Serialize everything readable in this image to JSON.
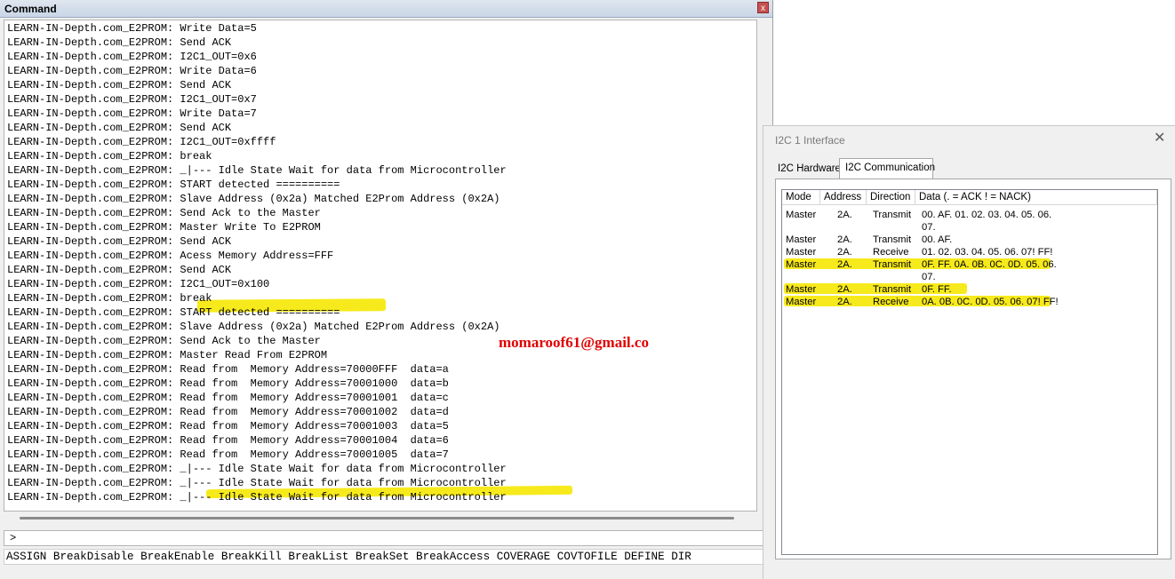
{
  "command_window": {
    "title": "Command",
    "close_glyph": "x",
    "lines": [
      "LEARN-IN-Depth.com_E2PROM: Write Data=5",
      "LEARN-IN-Depth.com_E2PROM: Send ACK",
      "LEARN-IN-Depth.com_E2PROM: I2C1_OUT=0x6",
      "LEARN-IN-Depth.com_E2PROM: Write Data=6",
      "LEARN-IN-Depth.com_E2PROM: Send ACK",
      "LEARN-IN-Depth.com_E2PROM: I2C1_OUT=0x7",
      "LEARN-IN-Depth.com_E2PROM: Write Data=7",
      "LEARN-IN-Depth.com_E2PROM: Send ACK",
      "LEARN-IN-Depth.com_E2PROM: I2C1_OUT=0xffff",
      "LEARN-IN-Depth.com_E2PROM: break",
      "LEARN-IN-Depth.com_E2PROM: _|--- Idle State Wait for data from Microcontroller",
      "LEARN-IN-Depth.com_E2PROM: START detected ==========",
      "LEARN-IN-Depth.com_E2PROM: Slave Address (0x2a) Matched E2Prom Address (0x2A)",
      "LEARN-IN-Depth.com_E2PROM: Send Ack to the Master",
      "LEARN-IN-Depth.com_E2PROM: Master Write To E2PROM",
      "LEARN-IN-Depth.com_E2PROM: Send ACK",
      "LEARN-IN-Depth.com_E2PROM: Acess Memory Address=FFF",
      "LEARN-IN-Depth.com_E2PROM: Send ACK",
      "LEARN-IN-Depth.com_E2PROM: I2C1_OUT=0x100",
      "LEARN-IN-Depth.com_E2PROM: break",
      "LEARN-IN-Depth.com_E2PROM: START detected ==========",
      "LEARN-IN-Depth.com_E2PROM: Slave Address (0x2a) Matched E2Prom Address (0x2A)",
      "LEARN-IN-Depth.com_E2PROM: Send Ack to the Master",
      "LEARN-IN-Depth.com_E2PROM: Master Read From E2PROM",
      "LEARN-IN-Depth.com_E2PROM: Read from  Memory Address=70000FFF  data=a",
      "LEARN-IN-Depth.com_E2PROM: Read from  Memory Address=70001000  data=b",
      "LEARN-IN-Depth.com_E2PROM: Read from  Memory Address=70001001  data=c",
      "LEARN-IN-Depth.com_E2PROM: Read from  Memory Address=70001002  data=d",
      "LEARN-IN-Depth.com_E2PROM: Read from  Memory Address=70001003  data=5",
      "LEARN-IN-Depth.com_E2PROM: Read from  Memory Address=70001004  data=6",
      "LEARN-IN-Depth.com_E2PROM: Read from  Memory Address=70001005  data=7",
      "LEARN-IN-Depth.com_E2PROM: _|--- Idle State Wait for data from Microcontroller",
      "LEARN-IN-Depth.com_E2PROM: _|--- Idle State Wait for data from Microcontroller",
      "LEARN-IN-Depth.com_E2PROM: _|--- Idle State Wait for data from Microcontroller"
    ],
    "prompt": ">",
    "command_hints": "ASSIGN BreakDisable BreakEnable BreakKill BreakList BreakSet BreakAccess COVERAGE COVTOFILE DEFINE DIR",
    "annotation": "momaroof61@gmail.co",
    "annotation_color": "#e00000",
    "highlight_color": "#f7ea1c"
  },
  "i2c_window": {
    "title": "I2C 1 Interface",
    "close_glyph": "✕",
    "tabs": [
      "I2C Hardware",
      "I2C Communication"
    ],
    "active_tab": "I2C Communication",
    "columns": [
      "Mode",
      "Address",
      "Direction",
      "Data (. = ACK   ! = NACK)"
    ],
    "rows": [
      {
        "mode": "Master",
        "address": "2A.",
        "direction": "Transmit",
        "data": [
          "00. AF. 01. 02. 03. 04. 05. 06.",
          "07."
        ],
        "highlighted": false
      },
      {
        "mode": "Master",
        "address": "2A.",
        "direction": "Transmit",
        "data": [
          "00. AF."
        ],
        "highlighted": false
      },
      {
        "mode": "Master",
        "address": "2A.",
        "direction": "Receive",
        "data": [
          "01. 02. 03. 04. 05. 06. 07! FF!"
        ],
        "highlighted": false
      },
      {
        "mode": "Master",
        "address": "2A.",
        "direction": "Transmit",
        "data": [
          "0F. FF. 0A. 0B. 0C. 0D. 05. 06.",
          "07."
        ],
        "highlighted": true
      },
      {
        "mode": "Master",
        "address": "2A.",
        "direction": "Transmit",
        "data": [
          "0F. FF."
        ],
        "highlighted": true
      },
      {
        "mode": "Master",
        "address": "2A.",
        "direction": "Receive",
        "data": [
          "0A. 0B. 0C. 0D. 05. 06. 07! FF!"
        ],
        "highlighted": true
      }
    ]
  }
}
